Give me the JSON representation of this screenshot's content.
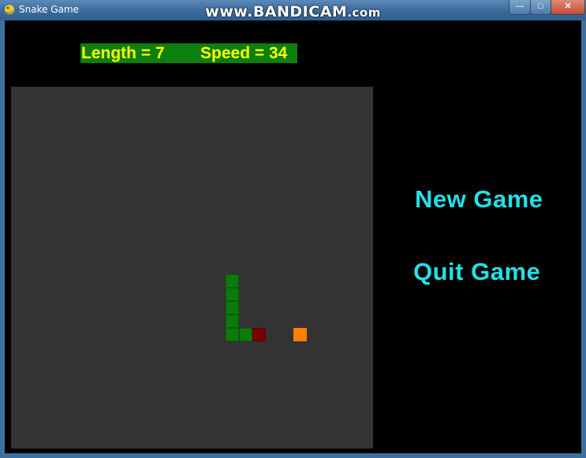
{
  "window": {
    "title": "Snake Game",
    "watermark_main": "www.BANDICAM",
    "watermark_suffix": ".com",
    "controls": {
      "minimize": "—",
      "maximize": "□",
      "close": "✕"
    }
  },
  "hud": {
    "length_text": "Length = 7",
    "speed_text": "Speed = 34",
    "length": 7,
    "speed": 34
  },
  "menu": {
    "new_game": "New Game",
    "quit_game": "Quit Game"
  },
  "board": {
    "grid_columns": 27,
    "grid_rows": 27,
    "snake": [
      {
        "col": 16,
        "row": 14,
        "part": "body"
      },
      {
        "col": 16,
        "row": 15,
        "part": "body"
      },
      {
        "col": 16,
        "row": 16,
        "part": "body"
      },
      {
        "col": 16,
        "row": 17,
        "part": "body"
      },
      {
        "col": 16,
        "row": 18,
        "part": "body"
      },
      {
        "col": 17,
        "row": 18,
        "part": "body"
      },
      {
        "col": 18,
        "row": 18,
        "part": "head"
      }
    ],
    "food": {
      "col": 21,
      "row": 18
    }
  },
  "colors": {
    "background": "#000000",
    "board": "#333333",
    "snake_body": "#0b7b0b",
    "snake_head": "#7a0000",
    "food": "#ff8000",
    "hud_bg": "#0c7f0c",
    "hud_text": "#ffff00",
    "menu_text": "#22e0e6"
  }
}
